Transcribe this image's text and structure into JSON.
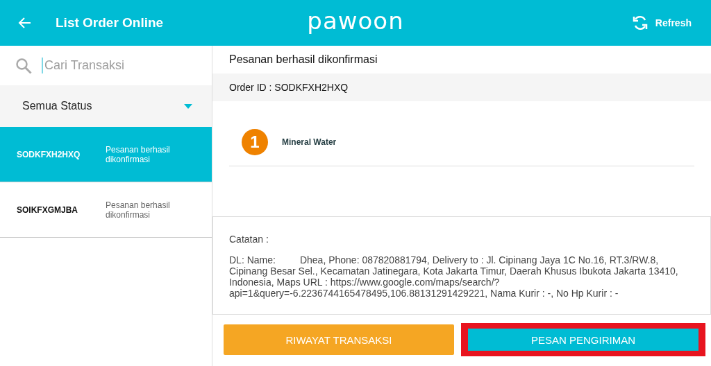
{
  "header": {
    "title": "List Order Online",
    "logo": "pawoon",
    "refresh": "Refresh"
  },
  "sidebar": {
    "search": {
      "placeholder": "Cari Transaksi"
    },
    "filter": "Semua Status",
    "orders": [
      {
        "id": "SODKFXH2HXQ",
        "status": "Pesanan berhasil dikonfirmasi",
        "selected": true
      },
      {
        "id": "SOIKFXGMJBA",
        "status": "Pesanan berhasil dikonfirmasi",
        "selected": false
      }
    ]
  },
  "detail": {
    "status": "Pesanan berhasil dikonfirmasi",
    "order_id": "Order ID : SODKFXH2HXQ",
    "items": [
      {
        "qty": "1",
        "name": "Mineral Water"
      }
    ],
    "note_label": "Catatan :",
    "note": "DL: Name:         Dhea, Phone: 087820881794, Delivery to : Jl. Cipinang Jaya 1C No.16, RT.3/RW.8, Cipinang Besar Sel., Kecamatan Jatinegara, Kota Jakarta Timur, Daerah Khusus Ibukota Jakarta 13410, Indonesia, Maps URL : https://www.google.com/maps/search/?api=1&query=-6.2236744165478495,106.88131291429221, Nama Kurir : -, No Hp Kurir : -"
  },
  "buttons": [
    {
      "label": "RIWAYAT TRANSAKSI",
      "kind": "history",
      "highlighted": false
    },
    {
      "label": "PESAN PENGIRIMAN",
      "kind": "delivery",
      "highlighted": true
    }
  ]
}
